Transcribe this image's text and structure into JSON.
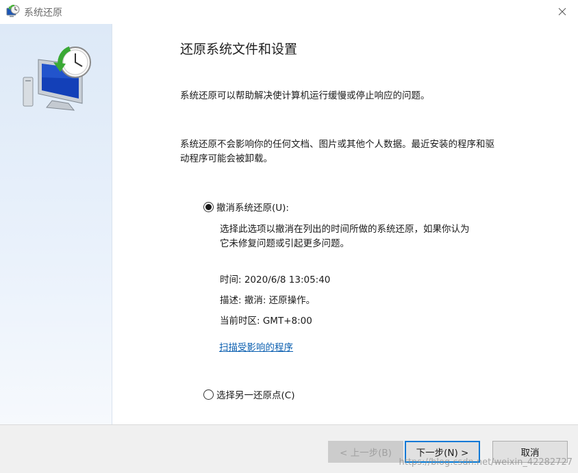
{
  "window": {
    "title": "系统还原",
    "close_symbol": "✕"
  },
  "content": {
    "heading": "还原系统文件和设置",
    "paragraph1": "系统还原可以帮助解决使计算机运行缓慢或停止响应的问题。",
    "paragraph2_line1": "系统还原不会影响你的任何文档、图片或其他个人数据。最近安装的程序和驱",
    "paragraph2_line2": "动程序可能会被卸载。",
    "option_undo": {
      "label": "撤消系统还原(U):",
      "selected": true,
      "desc_line1": "选择此选项以撤消在列出的时间所做的系统还原，如果你认为",
      "desc_line2": "它未修复问题或引起更多问题。",
      "time": "时间: 2020/6/8 13:05:40",
      "description": "描述: 撤消: 还原操作。",
      "timezone": "当前时区: GMT+8:00",
      "scan_link": "扫描受影响的程序"
    },
    "option_other": {
      "label": "选择另一还原点(C)",
      "selected": false
    }
  },
  "footer": {
    "back_label": "< 上一步(B)",
    "next_label": "下一步(N) >",
    "cancel_label": "取消"
  },
  "watermark": "https://blog.csdn.net/weixin_42282727",
  "colors": {
    "link": "#0b5fb0",
    "focus": "#0078d7"
  }
}
